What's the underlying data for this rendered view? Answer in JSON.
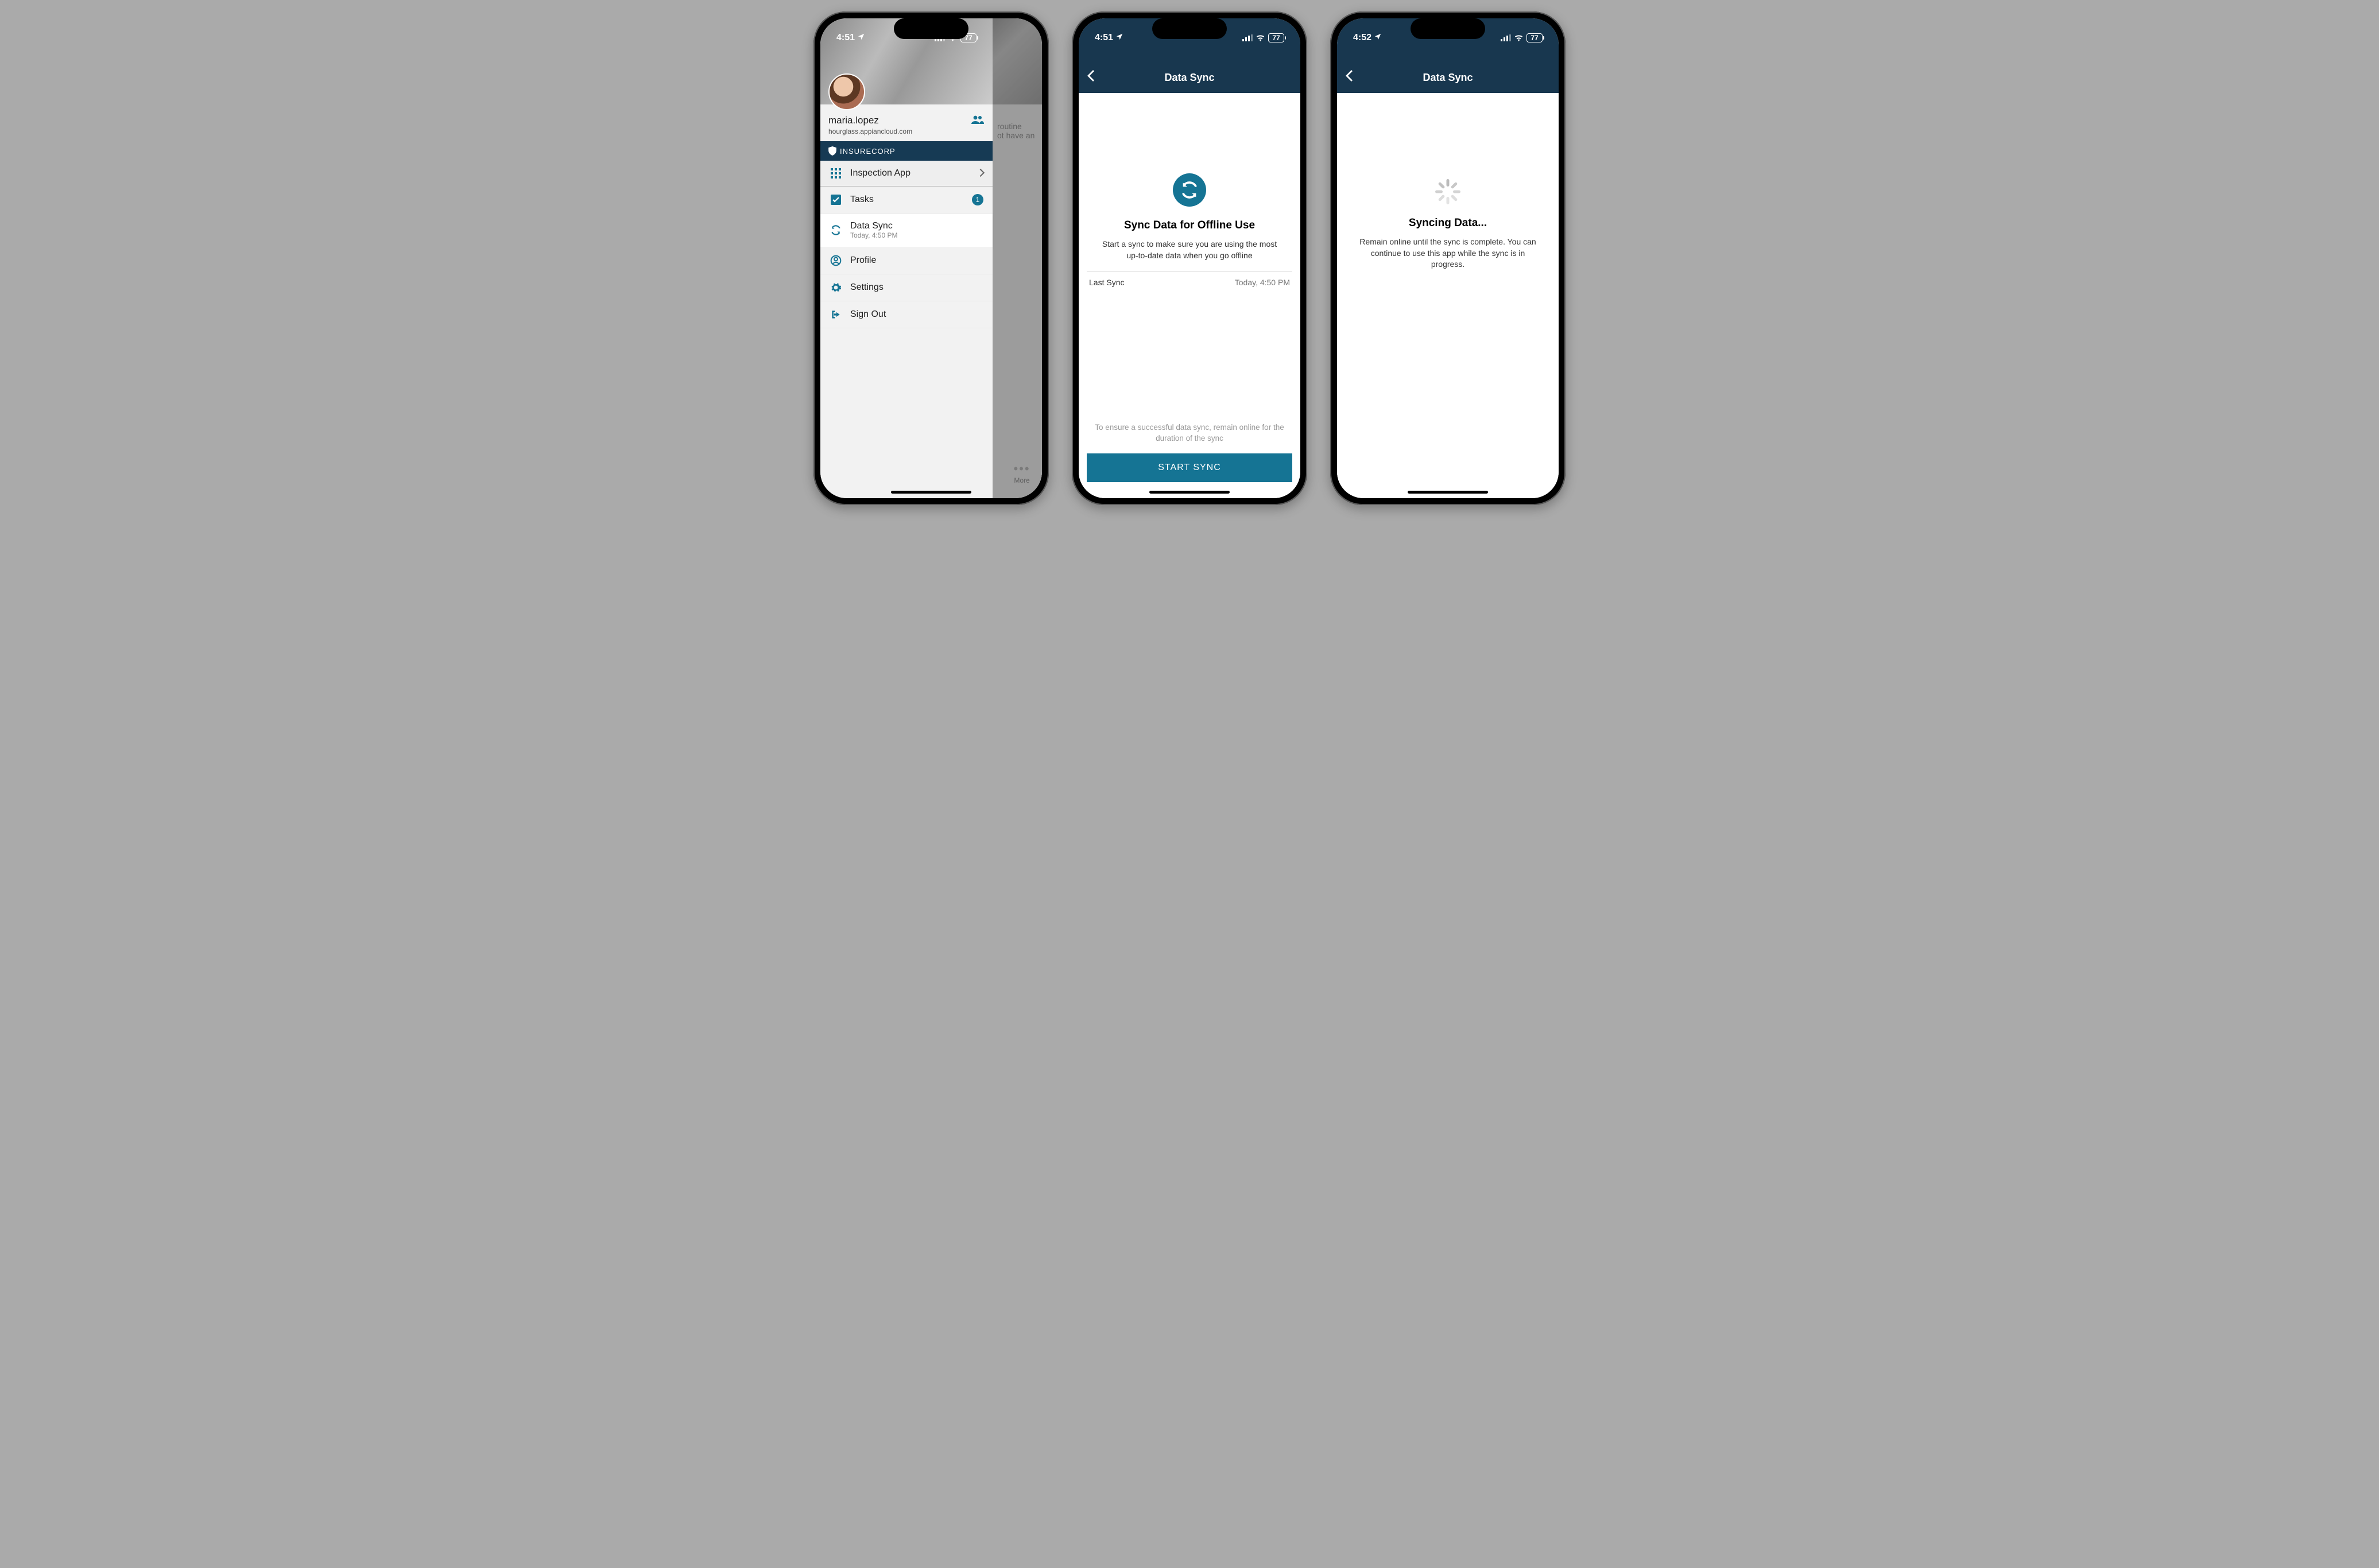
{
  "phones": [
    {
      "status": {
        "time": "4:51",
        "battery": "77"
      },
      "user": {
        "name": "maria.lopez",
        "host": "hourglass.appiancloud.com"
      },
      "brand": "INSURECORP",
      "app_switcher": "Inspection App",
      "menu": {
        "tasks": {
          "label": "Tasks",
          "badge": "1"
        },
        "datasync": {
          "label": "Data Sync",
          "sub": "Today, 4:50 PM"
        },
        "profile": "Profile",
        "settings": "Settings",
        "signout": "Sign Out"
      },
      "behind_text_1": "routine",
      "behind_text_2": "ot have an",
      "more": "More"
    },
    {
      "status": {
        "time": "4:51",
        "battery": "77"
      },
      "title": "Data Sync",
      "heading": "Sync Data for Offline Use",
      "desc": "Start a sync to make sure you are using the most up-to-date data when you go offline",
      "last_sync_label": "Last Sync",
      "last_sync_value": "Today, 4:50 PM",
      "footer_note": "To ensure a successful data sync, remain online for the duration of the sync",
      "button": "START SYNC"
    },
    {
      "status": {
        "time": "4:52",
        "battery": "77"
      },
      "title": "Data Sync",
      "heading": "Syncing Data...",
      "desc": "Remain online until the sync is complete. You can continue to use this app while the sync is in progress."
    }
  ]
}
